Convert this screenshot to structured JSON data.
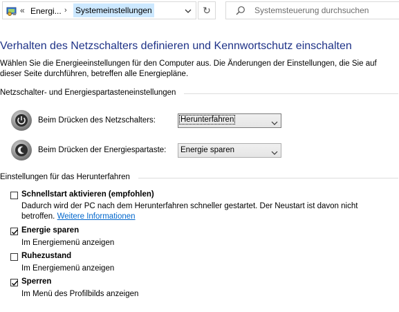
{
  "address_bar": {
    "breadcrumb_parent": "Energi...",
    "breadcrumb_current": "Systemeinstellungen",
    "search_placeholder": "Systemsteuerung durchsuchen"
  },
  "page": {
    "title": "Verhalten des Netzschalters definieren und Kennwortschutz einschalten",
    "intro": "Wählen Sie die Energieeinstellungen für den Computer aus. Die Änderungen der Einstellungen, die Sie auf dieser Seite durchführen, betreffen alle Energiepläne."
  },
  "power_settings": {
    "heading": "Netzschalter- und Energiespartasteneinstellungen",
    "power_button": {
      "label": "Beim Drücken des Netzschalters:",
      "selected": "Herunterfahren"
    },
    "sleep_button": {
      "label": "Beim Drücken der Energiespartaste:",
      "selected": "Energie sparen"
    }
  },
  "shutdown_settings": {
    "heading": "Einstellungen für das Herunterfahren",
    "items": [
      {
        "label": "Schnellstart aktivieren (empfohlen)",
        "checked": false,
        "description": "Dadurch wird der PC nach dem Herunterfahren schneller gestartet. Der Neustart ist davon nicht betroffen.",
        "link": "Weitere Informationen"
      },
      {
        "label": "Energie sparen",
        "checked": true,
        "description": "Im Energiemenü anzeigen"
      },
      {
        "label": "Ruhezustand",
        "checked": false,
        "description": "Im Energiemenü anzeigen"
      },
      {
        "label": "Sperren",
        "checked": true,
        "description": "Im Menü des Profilbilds anzeigen"
      }
    ]
  },
  "colors": {
    "title": "#1e3287",
    "link": "#0066cc",
    "breadcrumb_highlight": "#cce8ff"
  }
}
